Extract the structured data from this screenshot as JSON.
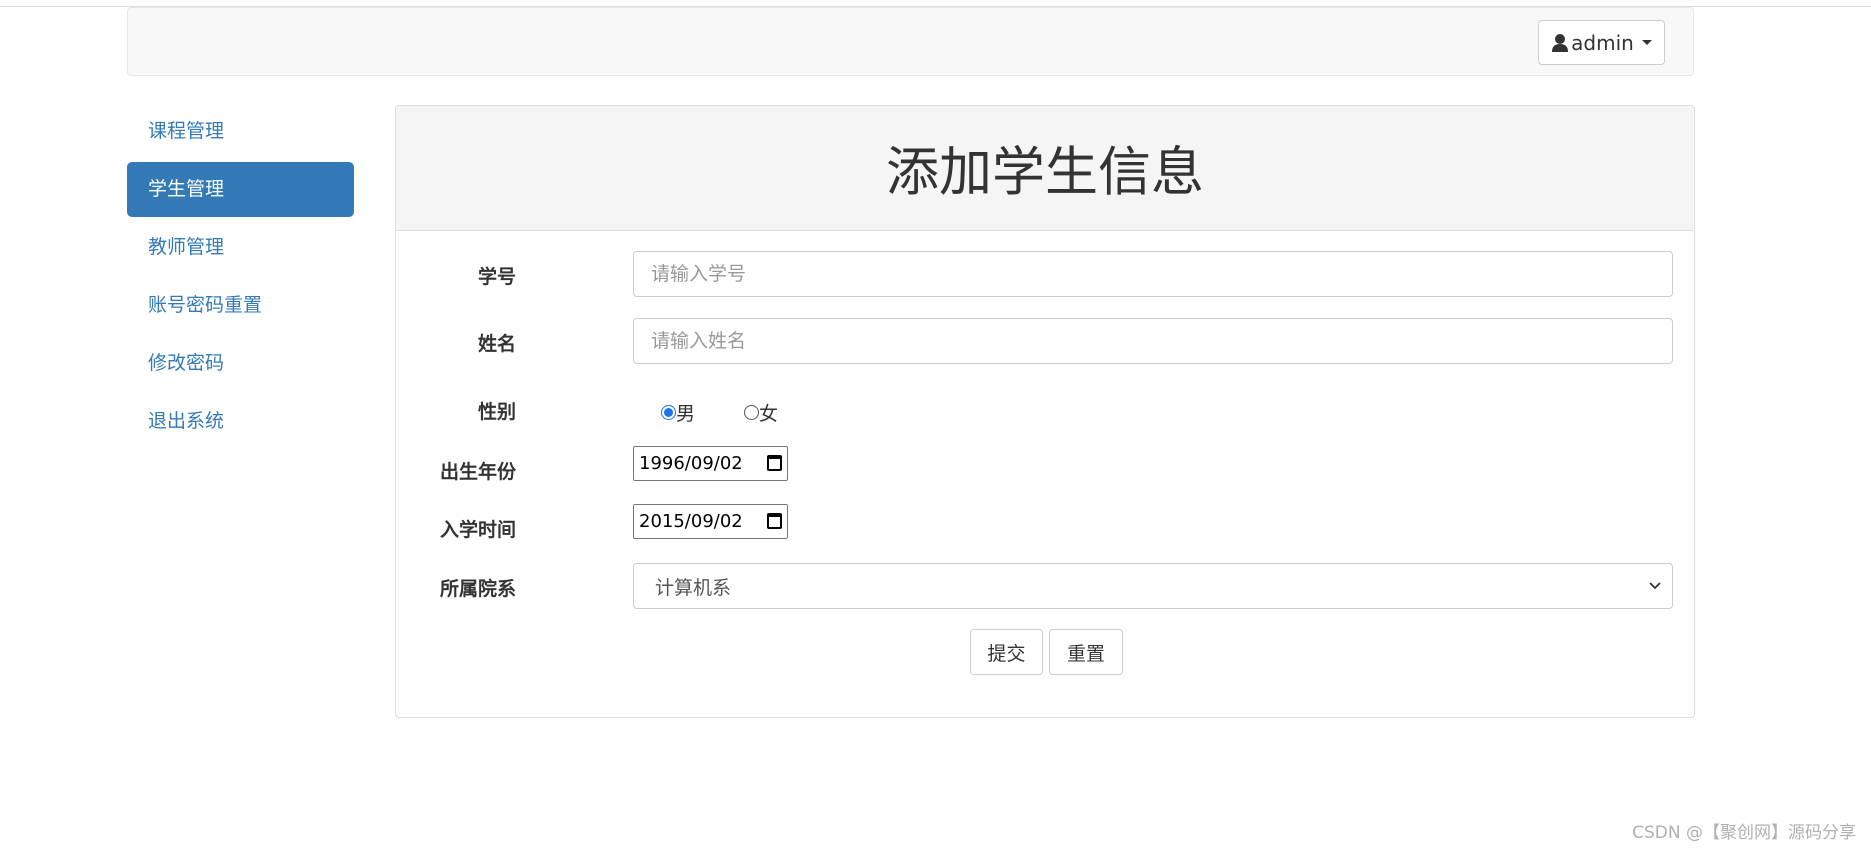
{
  "navbar": {
    "user_label": "admin"
  },
  "sidebar": {
    "items": [
      {
        "label": "课程管理",
        "active": false
      },
      {
        "label": "学生管理",
        "active": true
      },
      {
        "label": "教师管理",
        "active": false
      },
      {
        "label": "账号密码重置",
        "active": false
      },
      {
        "label": "修改密码",
        "active": false
      },
      {
        "label": "退出系统",
        "active": false
      }
    ]
  },
  "form": {
    "title": "添加学生信息",
    "student_id": {
      "label": "学号",
      "placeholder": "请输入学号",
      "value": ""
    },
    "name": {
      "label": "姓名",
      "placeholder": "请输入姓名",
      "value": ""
    },
    "gender": {
      "label": "性别",
      "options": [
        "男",
        "女"
      ],
      "selected": "男"
    },
    "birth": {
      "label": "出生年份",
      "value": "1996/09/02"
    },
    "enroll": {
      "label": "入学时间",
      "value": "2015/09/02"
    },
    "department": {
      "label": "所属院系",
      "selected": "计算机系"
    },
    "submit_label": "提交",
    "reset_label": "重置"
  },
  "watermark": "CSDN @【聚创网】源码分享",
  "colors": {
    "primary": "#337ab7",
    "navbar_bg": "#f8f8f8",
    "panel_heading_bg": "#f5f5f5"
  },
  "icons": {
    "user": "user-icon",
    "dropdown": "caret-down-icon",
    "calendar": "calendar-icon",
    "select": "chevron-down-icon"
  }
}
